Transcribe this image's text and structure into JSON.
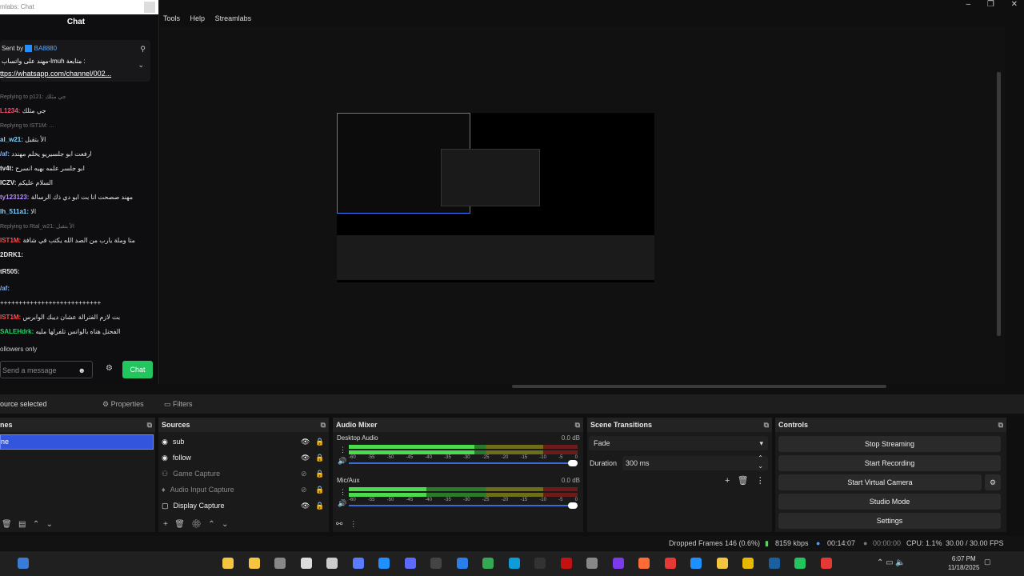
{
  "chat": {
    "window_title": "mlabs: Chat",
    "title": "Chat",
    "pinned": {
      "sent_by_label": "Sent by",
      "sent_by_user": "BA8880",
      "line1": "مهند على واتساب-lmuh متابعة :",
      "line2": "ttps://whatsapp.com/channel/002..."
    },
    "messages": [
      {
        "reply": "Replying to p121: جي مثلك",
        "user": "",
        "text": ""
      },
      {
        "user": "L1234:",
        "text": "جي مثلك",
        "color": "#ff4d6d"
      },
      {
        "reply": "Replying to IST1M: ...",
        "user": "",
        "text": ""
      },
      {
        "user": "al_w21:",
        "text": "الأ بتقبل",
        "color": "#7fd4ff"
      },
      {
        "user": "/af:",
        "text": "ارفعت ابو جلسيريو يخلم مهندد",
        "color": "#7fb3ff"
      },
      {
        "user": "tv4t:",
        "text": "ابو جلسر علمه بهيه انسرح",
        "color": "#e6e6e6"
      },
      {
        "user": "ICZV:",
        "text": "السلام عليكم",
        "color": "#e6e6e6"
      },
      {
        "user": "ty123123:",
        "text": "مهند صصحت انا بت ابو دي ذك الرسالة",
        "color": "#b38cff"
      },
      {
        "user": "lh_511a1:",
        "text": "الا",
        "color": "#7fd4ff"
      },
      {
        "reply": "Replying to Rtal_w21: الأ بتقبل",
        "user": "",
        "text": ""
      },
      {
        "user": "IST1M:",
        "text": "متا وملة يارب من الصد الله يكتب في شافة",
        "color": "#ff4d4d"
      },
      {
        "user": "2DRK1:",
        "text": "",
        "color": "#e6e6e6"
      },
      {
        "user": "tR505:",
        "text": "",
        "color": "#e6e6e6"
      },
      {
        "user": "/af:",
        "text": "",
        "color": "#7fb3ff"
      },
      {
        "user": "",
        "text": "+++++++++++++++++++++++++++",
        "color": "#e6e6e6"
      },
      {
        "user": "IST1M:",
        "text": "بت لازم الفترالة عشان ديبك الوابرس",
        "color": "#ff4d4d"
      },
      {
        "user": "SALEHdrk:",
        "text": "الفحنل هناه بالوانس تلفرلها مليه",
        "color": "#22d46b"
      }
    ],
    "followers_only": "ollowers only",
    "input_placeholder": "Send a message",
    "chat_button": "Chat"
  },
  "menu": [
    "Tools",
    "Help",
    "Streamlabs"
  ],
  "toolbar": {
    "no_source": "ource selected",
    "properties": "Properties",
    "filters": "Filters"
  },
  "scenes": {
    "title": "nes",
    "items": [
      "ne"
    ]
  },
  "sources": {
    "title": "Sources",
    "items": [
      {
        "name": "sub",
        "icon": "browser-icon",
        "active": true
      },
      {
        "name": "follow",
        "icon": "browser-icon",
        "active": true
      },
      {
        "name": "Game Capture",
        "icon": "gamepad-icon",
        "active": false
      },
      {
        "name": "Audio Input Capture",
        "icon": "mic-icon",
        "active": false
      },
      {
        "name": "Display Capture",
        "icon": "display-icon",
        "active": true
      }
    ]
  },
  "mixer": {
    "title": "Audio Mixer",
    "channels": [
      {
        "name": "Desktop Audio",
        "db": "0.0 dB",
        "level": 0.55
      },
      {
        "name": "Mic/Aux",
        "db": "0.0 dB",
        "level": 0.34
      }
    ],
    "scale": [
      "-60",
      "-55",
      "-50",
      "-45",
      "-40",
      "-35",
      "-30",
      "-25",
      "-20",
      "-15",
      "-10",
      "-5",
      "0"
    ]
  },
  "transitions": {
    "title": "Scene Transitions",
    "selected": "Fade",
    "duration_label": "Duration",
    "duration_value": "300 ms"
  },
  "controls": {
    "title": "Controls",
    "buttons": [
      "Stop Streaming",
      "Start Recording",
      "Start Virtual Camera",
      "Studio Mode",
      "Settings"
    ]
  },
  "status": {
    "dropped": "Dropped Frames 146 (0.6%)",
    "bitrate": "8159 kbps",
    "stream_time": "00:14:07",
    "rec_time": "00:00:00",
    "cpu": "CPU: 1.1%",
    "fps": "30.00 / 30.00 FPS"
  },
  "taskbar": {
    "time": "6:07 PM",
    "date": "11/18/2025"
  }
}
